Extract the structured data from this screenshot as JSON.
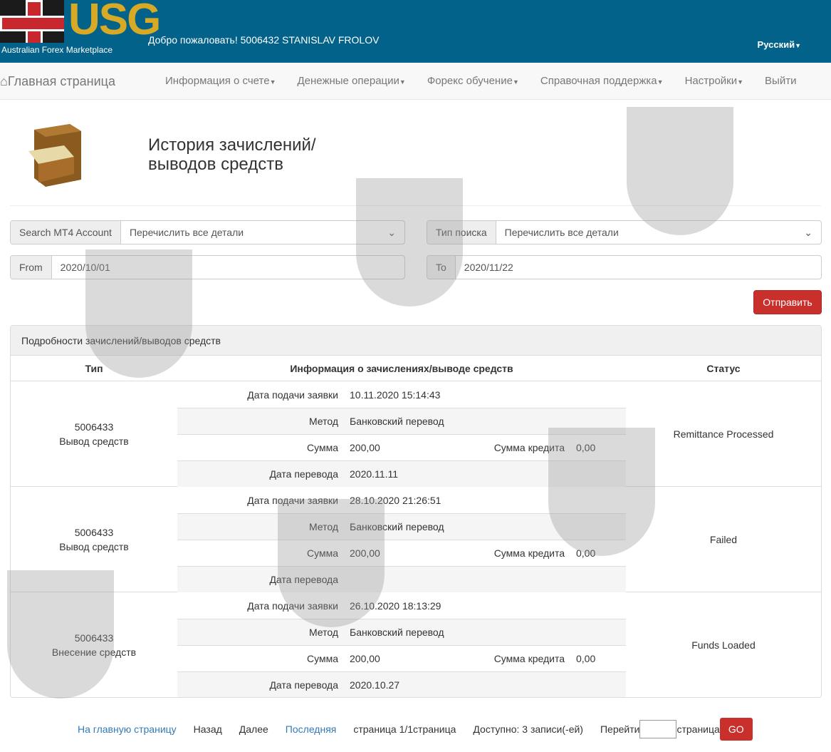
{
  "header": {
    "logo_text": "USG",
    "logo_tagline": "Australian Forex Marketplace",
    "welcome": "Добро пожаловать! 5006432 STANISLAV FROLOV",
    "language": "Русский"
  },
  "nav": {
    "home": "Главная страница",
    "items": [
      "Информация о счете",
      "Денежные операции",
      "Форекс обучение",
      "Справочная поддержка",
      "Настройки"
    ],
    "logout": "Выйти"
  },
  "page": {
    "title_line1": "История зачислений/",
    "title_line2": "выводов средств"
  },
  "filters": {
    "account_label": "Search MT4 Account",
    "account_value": "Перечислить все детали",
    "type_label": "Тип поиска",
    "type_value": "Перечислить все детали",
    "from_label": "From",
    "from_value": "2020/10/01",
    "to_label": "To",
    "to_value": "2020/11/22",
    "submit": "Отправить"
  },
  "panel": {
    "title": "Подробности зачислений/выводов средств",
    "columns": [
      "Тип",
      "Информация о зачислениях/выводе средств",
      "Статус"
    ],
    "labels": {
      "date": "Дата подачи заявки",
      "method": "Метод",
      "amount": "Сумма",
      "credit": "Сумма кредита",
      "transfer": "Дата перевода"
    },
    "records": [
      {
        "account": "5006433",
        "type": "Вывод средств",
        "date": "10.11.2020 15:14:43",
        "method": "Банковский перевод",
        "amount": "200,00",
        "credit": "0,00",
        "transfer": "2020.11.11",
        "status": "Remittance Processed"
      },
      {
        "account": "5006433",
        "type": "Вывод средств",
        "date": "28.10.2020 21:26:51",
        "method": "Банковский перевод",
        "amount": "200,00",
        "credit": "0,00",
        "transfer": "",
        "status": "Failed"
      },
      {
        "account": "5006433",
        "type": "Внесение средств",
        "date": "26.10.2020 18:13:29",
        "method": "Банковский перевод",
        "amount": "200,00",
        "credit": "0,00",
        "transfer": "2020.10.27",
        "status": "Funds Loaded"
      }
    ]
  },
  "pager": {
    "home": "На главную страницу",
    "prev": "Назад",
    "next": "Далее",
    "last": "Последняя",
    "page_info": "страница 1/1страница",
    "available": "Доступно: 3 записи(-ей)",
    "goto": "Перейти",
    "goto_suffix": "страница",
    "go": "GO"
  }
}
